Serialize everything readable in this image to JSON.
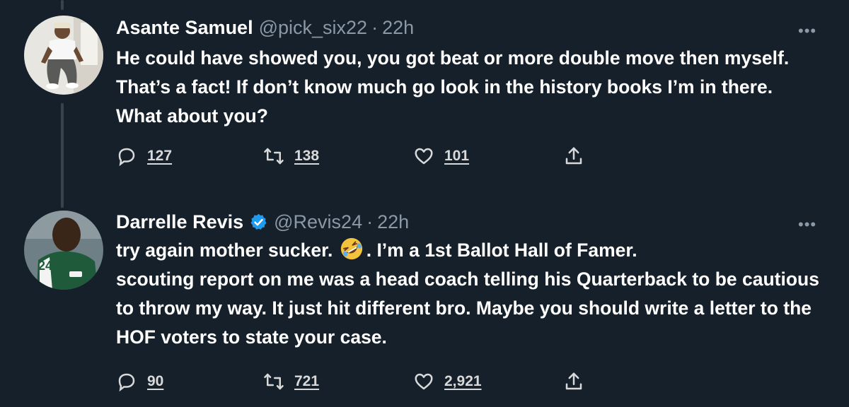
{
  "tweets": [
    {
      "name": "Asante Samuel",
      "handle": "@pick_six22",
      "separator": "·",
      "time": "22h",
      "more": "•••",
      "text": "He could have showed you, you got beat or more double move then myself. That’s a fact! If don’t know much go look in the history books I’m in there. What about you?",
      "replies": "127",
      "retweets": "138",
      "likes": "101",
      "verified": false
    },
    {
      "name": "Darrelle Revis",
      "handle": "@Revis24",
      "separator": "·",
      "time": "22h",
      "more": "•••",
      "text_before_emoji": "try again mother sucker.",
      "emoji": "rolling-on-floor-laughing",
      "text_after_emoji": ". I’m a 1st Ballot Hall of Famer.\nscouting report on me was a head coach telling his Quarterback to be cautious to throw my way. It just hit different bro. Maybe you should write a letter to the HOF voters to state your case.",
      "replies": "90",
      "retweets": "721",
      "likes": "2,921",
      "verified": true,
      "avatar_jersey_number": "24"
    }
  ],
  "colors": {
    "background": "#15202b",
    "secondary_text": "#8b98a5",
    "thread_line": "#38444d",
    "verified_blue": "#1d9bf0"
  }
}
